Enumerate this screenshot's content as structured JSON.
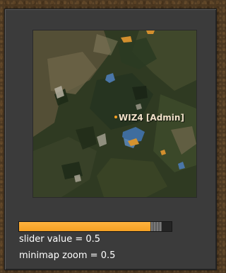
{
  "minimap": {
    "player_name": "WIZ4 [Admin]"
  },
  "slider": {
    "value": 0.5,
    "fill_color": "#f5a023"
  },
  "readouts": {
    "slider_text": "slider value = 0.5",
    "zoom_text": "minimap zoom = 0.5"
  }
}
